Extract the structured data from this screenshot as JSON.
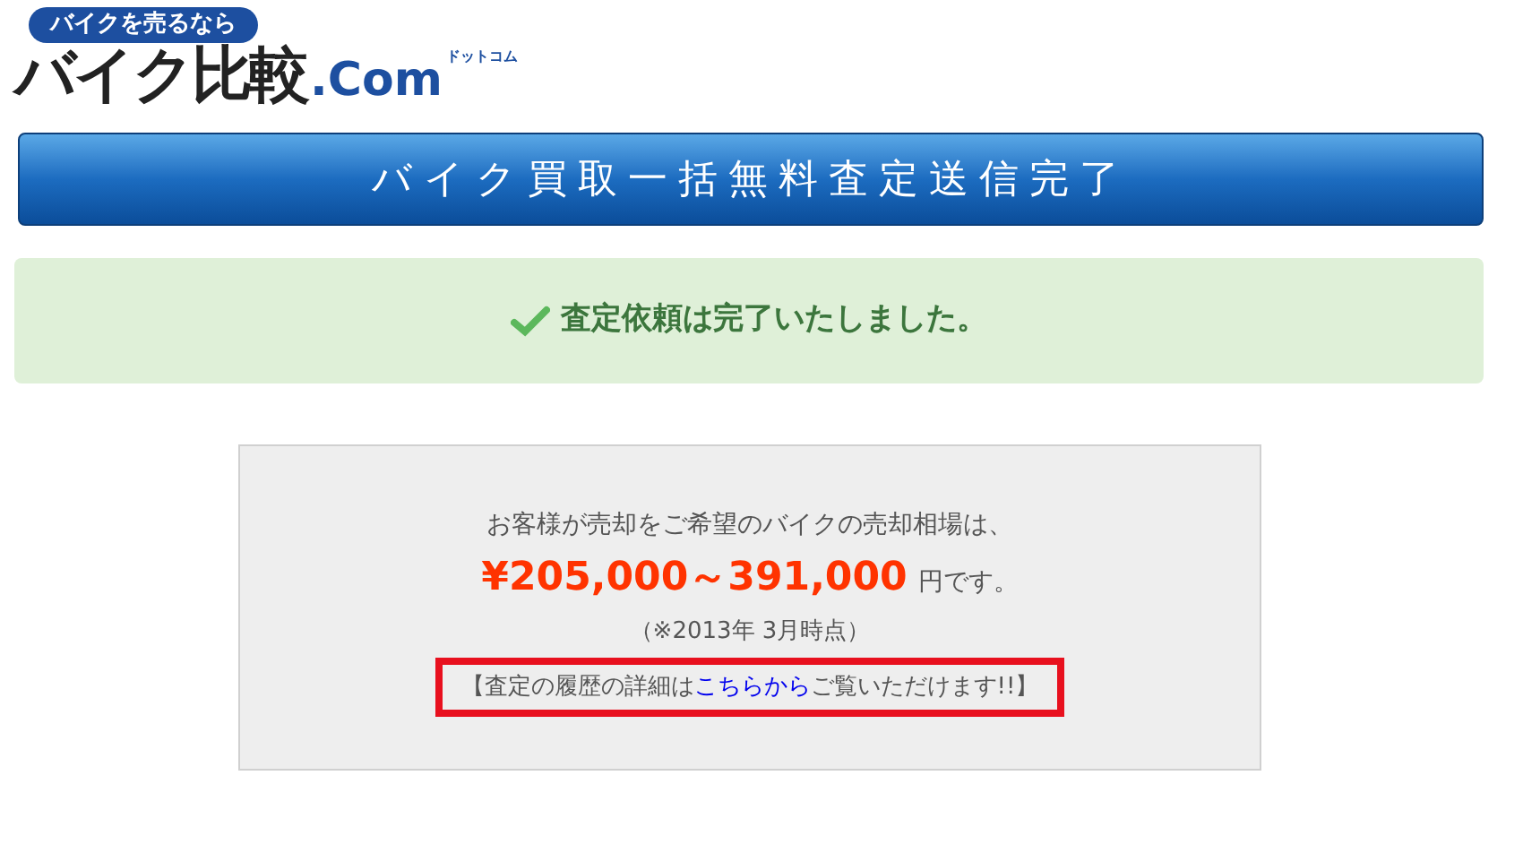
{
  "logo": {
    "tagline": "バイクを売るなら",
    "name": "バイク比較",
    "suffix": ".Com",
    "reading": "ドットコム"
  },
  "banner": {
    "title": "バイク買取一括無料査定送信完了"
  },
  "alert": {
    "message": "査定依頼は完了いたしました。"
  },
  "result": {
    "intro": "お客様が売却をご希望のバイクの売却相場は、",
    "price": "¥205,000～391,000",
    "unit": "円です。",
    "note": "（※2013年 3月時点）",
    "history": {
      "before": "【査定の履歴の詳細は",
      "link": "こちらから",
      "after": "ご覧いただけます!!】",
      "highlighted": true
    }
  }
}
